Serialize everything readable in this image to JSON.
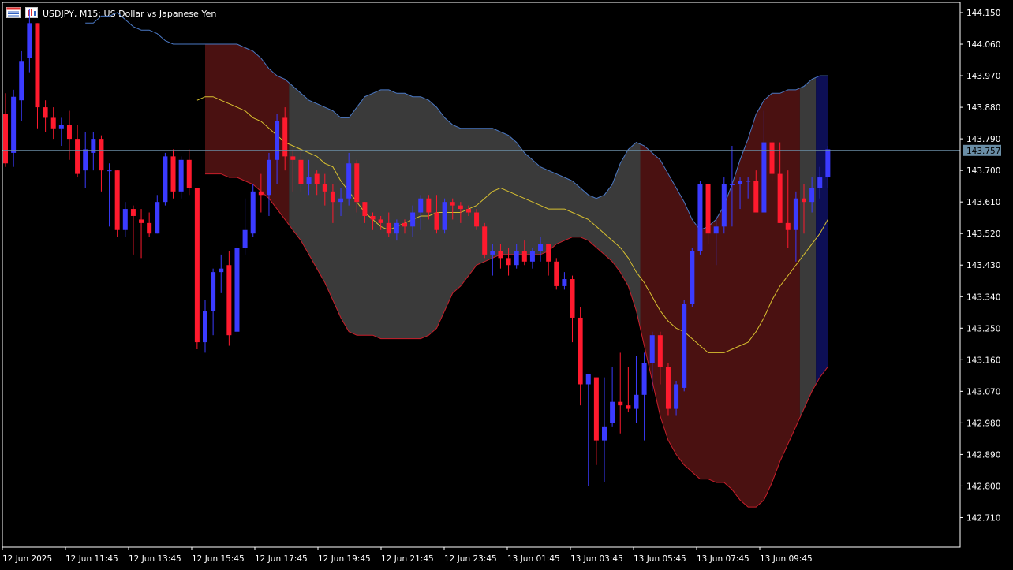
{
  "header": {
    "symbol_title": "USDJPY, M15:  US Dollar vs Japanese Yen",
    "icons": [
      "calendar-grid-icon",
      "chart-window-icon"
    ]
  },
  "chart_data": {
    "type": "candlestick",
    "symbol": "USDJPY",
    "timeframe": "M15",
    "description": "US Dollar vs Japanese Yen",
    "ylim": [
      142.66,
      144.17
    ],
    "y_ticks": [
      "144.150",
      "144.060",
      "143.970",
      "143.880",
      "143.790",
      "143.700",
      "143.610",
      "143.520",
      "143.430",
      "143.340",
      "143.250",
      "143.160",
      "143.070",
      "142.980",
      "142.890",
      "142.800",
      "142.710"
    ],
    "x_ticks": [
      "12 Jun 2025",
      "12 Jun 11:45",
      "12 Jun 13:45",
      "12 Jun 15:45",
      "12 Jun 17:45",
      "12 Jun 19:45",
      "12 Jun 21:45",
      "12 Jun 23:45",
      "13 Jun 01:45",
      "13 Jun 03:45",
      "13 Jun 05:45",
      "13 Jun 07:45",
      "13 Jun 09:45"
    ],
    "current_price": 143.757,
    "current_price_label": "143.757",
    "colors": {
      "background": "#000000",
      "bull_candle": "#3b3bff",
      "bear_candle": "#ff1a2e",
      "band_neutral": "#3a3a3a",
      "band_bear": "#4a1111",
      "band_bull": "#0d0f55",
      "upper_band_line": "#4a78c4",
      "lower_band_line": "#c81e2a",
      "middle_line": "#d8c030",
      "price_line": "#6a8ea6",
      "axis": "#ffffff"
    },
    "bands": {
      "upper": [
        144.12,
        144.12,
        144.14,
        144.14,
        144.15,
        144.13,
        144.11,
        144.1,
        144.1,
        144.09,
        144.07,
        144.06,
        144.06,
        144.06,
        144.06,
        144.06,
        144.06,
        144.06,
        144.06,
        144.06,
        144.05,
        144.04,
        144.02,
        143.99,
        143.97,
        143.96,
        143.94,
        143.92,
        143.9,
        143.89,
        143.88,
        143.87,
        143.85,
        143.85,
        143.88,
        143.91,
        143.92,
        143.93,
        143.93,
        143.92,
        143.92,
        143.91,
        143.91,
        143.9,
        143.88,
        143.85,
        143.83,
        143.82,
        143.82,
        143.82,
        143.82,
        143.82,
        143.81,
        143.8,
        143.78,
        143.75,
        143.73,
        143.71,
        143.7,
        143.69,
        143.68,
        143.67,
        143.65,
        143.63,
        143.62,
        143.63,
        143.66,
        143.72,
        143.76,
        143.78,
        143.77,
        143.75,
        143.73,
        143.69,
        143.65,
        143.61,
        143.56,
        143.53,
        143.54,
        143.56,
        143.6,
        143.66,
        143.73,
        143.79,
        143.86,
        143.9,
        143.92,
        143.92,
        143.93,
        143.93,
        143.94,
        143.96,
        143.97,
        143.97
      ],
      "middle": [
        143.9,
        143.91,
        143.91,
        143.9,
        143.89,
        143.88,
        143.87,
        143.85,
        143.84,
        143.82,
        143.8,
        143.78,
        143.77,
        143.76,
        143.75,
        143.74,
        143.72,
        143.71,
        143.67,
        143.64,
        143.61,
        143.58,
        143.56,
        143.54,
        143.53,
        143.54,
        143.55,
        143.56,
        143.57,
        143.57,
        143.58,
        143.58,
        143.58,
        143.58,
        143.59,
        143.6,
        143.62,
        143.64,
        143.65,
        143.64,
        143.63,
        143.62,
        143.61,
        143.6,
        143.59,
        143.59,
        143.59,
        143.58,
        143.57,
        143.56,
        143.54,
        143.52,
        143.5,
        143.48,
        143.45,
        143.41,
        143.38,
        143.34,
        143.3,
        143.27,
        143.25,
        143.24,
        143.22,
        143.2,
        143.18,
        143.18,
        143.18,
        143.19,
        143.2,
        143.21,
        143.24,
        143.28,
        143.33,
        143.37,
        143.4,
        143.43,
        143.46,
        143.49,
        143.52,
        143.56
      ],
      "lower": [
        143.69,
        143.69,
        143.69,
        143.68,
        143.68,
        143.67,
        143.66,
        143.64,
        143.62,
        143.59,
        143.56,
        143.53,
        143.5,
        143.46,
        143.42,
        143.38,
        143.33,
        143.28,
        143.24,
        143.23,
        143.23,
        143.23,
        143.22,
        143.22,
        143.22,
        143.22,
        143.22,
        143.22,
        143.23,
        143.25,
        143.3,
        143.35,
        143.37,
        143.4,
        143.43,
        143.44,
        143.45,
        143.46,
        143.46,
        143.46,
        143.46,
        143.46,
        143.46,
        143.47,
        143.49,
        143.5,
        143.51,
        143.51,
        143.5,
        143.48,
        143.46,
        143.44,
        143.41,
        143.37,
        143.3,
        143.2,
        143.1,
        143.0,
        142.93,
        142.89,
        142.86,
        142.84,
        142.82,
        142.82,
        142.81,
        142.81,
        142.79,
        142.76,
        142.74,
        142.74,
        142.76,
        142.81,
        142.87,
        142.92,
        142.97,
        143.02,
        143.07,
        143.11,
        143.14
      ]
    },
    "band_regimes": [
      {
        "from": 0,
        "to": 16,
        "state": "neutral"
      },
      {
        "from": 16,
        "to": 36,
        "state": "bear"
      },
      {
        "from": 36,
        "to": 80,
        "state": "neutral"
      },
      {
        "from": 80,
        "to": 100,
        "state": "bear"
      },
      {
        "from": 100,
        "to": 102,
        "state": "neutral"
      },
      {
        "from": 102,
        "to": 122,
        "state": "bull"
      }
    ],
    "candles": [
      {
        "o": 143.86,
        "h": 143.92,
        "l": 143.71,
        "c": 143.72
      },
      {
        "o": 143.75,
        "h": 143.93,
        "l": 143.71,
        "c": 143.91
      },
      {
        "o": 143.9,
        "h": 144.04,
        "l": 143.84,
        "c": 144.01
      },
      {
        "o": 144.02,
        "h": 144.16,
        "l": 143.98,
        "c": 144.12
      },
      {
        "o": 144.12,
        "h": 144.12,
        "l": 143.82,
        "c": 143.88
      },
      {
        "o": 143.88,
        "h": 143.9,
        "l": 143.81,
        "c": 143.85
      },
      {
        "o": 143.85,
        "h": 143.88,
        "l": 143.79,
        "c": 143.82
      },
      {
        "o": 143.82,
        "h": 143.85,
        "l": 143.77,
        "c": 143.83
      },
      {
        "o": 143.83,
        "h": 143.87,
        "l": 143.73,
        "c": 143.79
      },
      {
        "o": 143.79,
        "h": 143.83,
        "l": 143.68,
        "c": 143.69
      },
      {
        "o": 143.7,
        "h": 143.81,
        "l": 143.65,
        "c": 143.76
      },
      {
        "o": 143.75,
        "h": 143.81,
        "l": 143.7,
        "c": 143.79
      },
      {
        "o": 143.79,
        "h": 143.8,
        "l": 143.64,
        "c": 143.7
      },
      {
        "o": 143.7,
        "h": 143.72,
        "l": 143.54,
        "c": 143.7
      },
      {
        "o": 143.7,
        "h": 143.7,
        "l": 143.51,
        "c": 143.53
      },
      {
        "o": 143.53,
        "h": 143.61,
        "l": 143.51,
        "c": 143.59
      },
      {
        "o": 143.59,
        "h": 143.6,
        "l": 143.46,
        "c": 143.57
      },
      {
        "o": 143.56,
        "h": 143.59,
        "l": 143.45,
        "c": 143.55
      },
      {
        "o": 143.55,
        "h": 143.58,
        "l": 143.51,
        "c": 143.52
      },
      {
        "o": 143.52,
        "h": 143.63,
        "l": 143.52,
        "c": 143.61
      },
      {
        "o": 143.61,
        "h": 143.75,
        "l": 143.6,
        "c": 143.74
      },
      {
        "o": 143.74,
        "h": 143.76,
        "l": 143.62,
        "c": 143.64
      },
      {
        "o": 143.64,
        "h": 143.74,
        "l": 143.62,
        "c": 143.73
      },
      {
        "o": 143.73,
        "h": 143.76,
        "l": 143.63,
        "c": 143.65
      },
      {
        "o": 143.65,
        "h": 143.59,
        "l": 143.19,
        "c": 143.21
      },
      {
        "o": 143.21,
        "h": 143.33,
        "l": 143.18,
        "c": 143.3
      },
      {
        "o": 143.3,
        "h": 143.42,
        "l": 143.23,
        "c": 143.41
      },
      {
        "o": 143.41,
        "h": 143.46,
        "l": 143.35,
        "c": 143.42
      },
      {
        "o": 143.43,
        "h": 143.47,
        "l": 143.2,
        "c": 143.23
      },
      {
        "o": 143.24,
        "h": 143.49,
        "l": 143.23,
        "c": 143.48
      },
      {
        "o": 143.48,
        "h": 143.62,
        "l": 143.46,
        "c": 143.53
      },
      {
        "o": 143.52,
        "h": 143.66,
        "l": 143.51,
        "c": 143.64
      },
      {
        "o": 143.64,
        "h": 143.69,
        "l": 143.58,
        "c": 143.63
      },
      {
        "o": 143.63,
        "h": 143.75,
        "l": 143.57,
        "c": 143.73
      },
      {
        "o": 143.73,
        "h": 143.86,
        "l": 143.66,
        "c": 143.84
      },
      {
        "o": 143.85,
        "h": 143.88,
        "l": 143.7,
        "c": 143.74
      },
      {
        "o": 143.74,
        "h": 143.76,
        "l": 143.64,
        "c": 143.73
      },
      {
        "o": 143.73,
        "h": 143.76,
        "l": 143.64,
        "c": 143.66
      },
      {
        "o": 143.66,
        "h": 143.73,
        "l": 143.63,
        "c": 143.68
      },
      {
        "o": 143.69,
        "h": 143.7,
        "l": 143.63,
        "c": 143.66
      },
      {
        "o": 143.66,
        "h": 143.69,
        "l": 143.6,
        "c": 143.64
      },
      {
        "o": 143.64,
        "h": 143.66,
        "l": 143.55,
        "c": 143.61
      },
      {
        "o": 143.61,
        "h": 143.65,
        "l": 143.57,
        "c": 143.62
      },
      {
        "o": 143.62,
        "h": 143.75,
        "l": 143.6,
        "c": 143.72
      },
      {
        "o": 143.72,
        "h": 143.73,
        "l": 143.58,
        "c": 143.61
      },
      {
        "o": 143.61,
        "h": 143.61,
        "l": 143.55,
        "c": 143.57
      },
      {
        "o": 143.57,
        "h": 143.58,
        "l": 143.53,
        "c": 143.56
      },
      {
        "o": 143.56,
        "h": 143.57,
        "l": 143.53,
        "c": 143.55
      },
      {
        "o": 143.55,
        "h": 143.58,
        "l": 143.51,
        "c": 143.52
      },
      {
        "o": 143.52,
        "h": 143.56,
        "l": 143.5,
        "c": 143.55
      },
      {
        "o": 143.55,
        "h": 143.56,
        "l": 143.52,
        "c": 143.54
      },
      {
        "o": 143.54,
        "h": 143.6,
        "l": 143.51,
        "c": 143.58
      },
      {
        "o": 143.58,
        "h": 143.63,
        "l": 143.53,
        "c": 143.62
      },
      {
        "o": 143.62,
        "h": 143.63,
        "l": 143.56,
        "c": 143.58
      },
      {
        "o": 143.58,
        "h": 143.63,
        "l": 143.52,
        "c": 143.53
      },
      {
        "o": 143.53,
        "h": 143.62,
        "l": 143.52,
        "c": 143.61
      },
      {
        "o": 143.61,
        "h": 143.62,
        "l": 143.56,
        "c": 143.6
      },
      {
        "o": 143.6,
        "h": 143.61,
        "l": 143.55,
        "c": 143.59
      },
      {
        "o": 143.59,
        "h": 143.6,
        "l": 143.57,
        "c": 143.58
      },
      {
        "o": 143.58,
        "h": 143.59,
        "l": 143.53,
        "c": 143.54
      },
      {
        "o": 143.54,
        "h": 143.55,
        "l": 143.45,
        "c": 143.46
      },
      {
        "o": 143.46,
        "h": 143.49,
        "l": 143.4,
        "c": 143.47
      },
      {
        "o": 143.47,
        "h": 143.49,
        "l": 143.42,
        "c": 143.45
      },
      {
        "o": 143.45,
        "h": 143.48,
        "l": 143.4,
        "c": 143.43
      },
      {
        "o": 143.43,
        "h": 143.49,
        "l": 143.42,
        "c": 143.47
      },
      {
        "o": 143.47,
        "h": 143.5,
        "l": 143.43,
        "c": 143.44
      },
      {
        "o": 143.44,
        "h": 143.48,
        "l": 143.42,
        "c": 143.47
      },
      {
        "o": 143.47,
        "h": 143.51,
        "l": 143.44,
        "c": 143.49
      },
      {
        "o": 143.49,
        "h": 143.49,
        "l": 143.4,
        "c": 143.44
      },
      {
        "o": 143.44,
        "h": 143.45,
        "l": 143.36,
        "c": 143.37
      },
      {
        "o": 143.37,
        "h": 143.41,
        "l": 143.36,
        "c": 143.39
      },
      {
        "o": 143.39,
        "h": 143.4,
        "l": 143.21,
        "c": 143.28
      },
      {
        "o": 143.28,
        "h": 143.31,
        "l": 143.03,
        "c": 143.09
      },
      {
        "o": 143.09,
        "h": 143.12,
        "l": 142.8,
        "c": 143.12
      },
      {
        "o": 143.11,
        "h": 143.11,
        "l": 142.86,
        "c": 142.93
      },
      {
        "o": 142.93,
        "h": 143.11,
        "l": 142.81,
        "c": 142.97
      },
      {
        "o": 142.98,
        "h": 143.14,
        "l": 142.97,
        "c": 143.04
      },
      {
        "o": 143.04,
        "h": 143.18,
        "l": 142.95,
        "c": 143.03
      },
      {
        "o": 143.03,
        "h": 143.14,
        "l": 143.01,
        "c": 143.02
      },
      {
        "o": 143.02,
        "h": 143.17,
        "l": 142.98,
        "c": 143.06
      },
      {
        "o": 143.06,
        "h": 143.18,
        "l": 142.93,
        "c": 143.15
      },
      {
        "o": 143.15,
        "h": 143.24,
        "l": 143.07,
        "c": 143.23
      },
      {
        "o": 143.23,
        "h": 143.24,
        "l": 143.09,
        "c": 143.14
      },
      {
        "o": 143.14,
        "h": 143.15,
        "l": 143.0,
        "c": 143.02
      },
      {
        "o": 143.02,
        "h": 143.1,
        "l": 143.0,
        "c": 143.09
      },
      {
        "o": 143.08,
        "h": 143.33,
        "l": 143.07,
        "c": 143.32
      },
      {
        "o": 143.32,
        "h": 143.48,
        "l": 143.31,
        "c": 143.47
      },
      {
        "o": 143.47,
        "h": 143.67,
        "l": 143.46,
        "c": 143.66
      },
      {
        "o": 143.66,
        "h": 143.66,
        "l": 143.49,
        "c": 143.52
      },
      {
        "o": 143.52,
        "h": 143.57,
        "l": 143.43,
        "c": 143.54
      },
      {
        "o": 143.54,
        "h": 143.68,
        "l": 143.52,
        "c": 143.66
      },
      {
        "o": 143.66,
        "h": 143.77,
        "l": 143.54,
        "c": 143.66
      },
      {
        "o": 143.66,
        "h": 143.68,
        "l": 143.59,
        "c": 143.67
      },
      {
        "o": 143.67,
        "h": 143.68,
        "l": 143.62,
        "c": 143.67
      },
      {
        "o": 143.67,
        "h": 143.7,
        "l": 143.59,
        "c": 143.58
      },
      {
        "o": 143.58,
        "h": 143.87,
        "l": 143.58,
        "c": 143.78
      },
      {
        "o": 143.78,
        "h": 143.79,
        "l": 143.67,
        "c": 143.69
      },
      {
        "o": 143.69,
        "h": 143.78,
        "l": 143.55,
        "c": 143.55
      },
      {
        "o": 143.55,
        "h": 143.7,
        "l": 143.48,
        "c": 143.53
      },
      {
        "o": 143.53,
        "h": 143.64,
        "l": 143.44,
        "c": 143.62
      },
      {
        "o": 143.62,
        "h": 143.66,
        "l": 143.52,
        "c": 143.61
      },
      {
        "o": 143.61,
        "h": 143.68,
        "l": 143.58,
        "c": 143.65
      },
      {
        "o": 143.65,
        "h": 143.71,
        "l": 143.62,
        "c": 143.68
      },
      {
        "o": 143.68,
        "h": 143.77,
        "l": 143.65,
        "c": 143.76
      }
    ]
  }
}
